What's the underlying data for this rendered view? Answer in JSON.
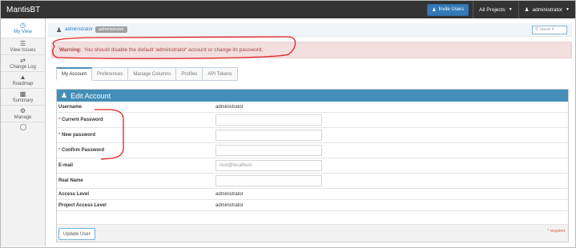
{
  "navbar": {
    "brand": "MantisBT",
    "invite_label": "Invite Users",
    "projects_label": "All Projects",
    "user_label": "administrator"
  },
  "sidebar": {
    "items": [
      {
        "label": "My View",
        "icon": "dashboard-icon",
        "active": true
      },
      {
        "label": "View Issues",
        "icon": "list-icon"
      },
      {
        "label": "Change Log",
        "icon": "retweet-icon"
      },
      {
        "label": "Roadmap",
        "icon": "road-icon"
      },
      {
        "label": "Summary",
        "icon": "bar-chart-icon"
      },
      {
        "label": "Manage",
        "icon": "gears-icon"
      }
    ]
  },
  "breadcrumb": {
    "user": "administrator",
    "role_badge": "administrator",
    "search_placeholder": "Issue #"
  },
  "warning": {
    "prefix": "Warning:",
    "text": "You should disable the default 'administrator' account or change its password."
  },
  "tabs": [
    "My Account",
    "Preferences",
    "Manage Columns",
    "Profiles",
    "API Tokens"
  ],
  "form": {
    "title": "Edit Account",
    "rows": {
      "username": {
        "label": "Username",
        "value": "administrator"
      },
      "current_password": {
        "label": "Current Password"
      },
      "new_password": {
        "label": "New password"
      },
      "confirm_password": {
        "label": "Confirm Password"
      },
      "email": {
        "label": "E-mail",
        "value": "root@localhost"
      },
      "real_name": {
        "label": "Real Name"
      },
      "access_level": {
        "label": "Access Level",
        "value": "administrator"
      },
      "project_access_level": {
        "label": "Project Access Level",
        "value": "administrator"
      }
    },
    "required_marker": "*",
    "update_button": "Update User",
    "required_note": "* required"
  },
  "colors": {
    "navbar": "#333333",
    "accent": "#438eb9",
    "warning_bg": "#f2dede",
    "warning_text": "#a94442",
    "annotation": "#e02020"
  }
}
